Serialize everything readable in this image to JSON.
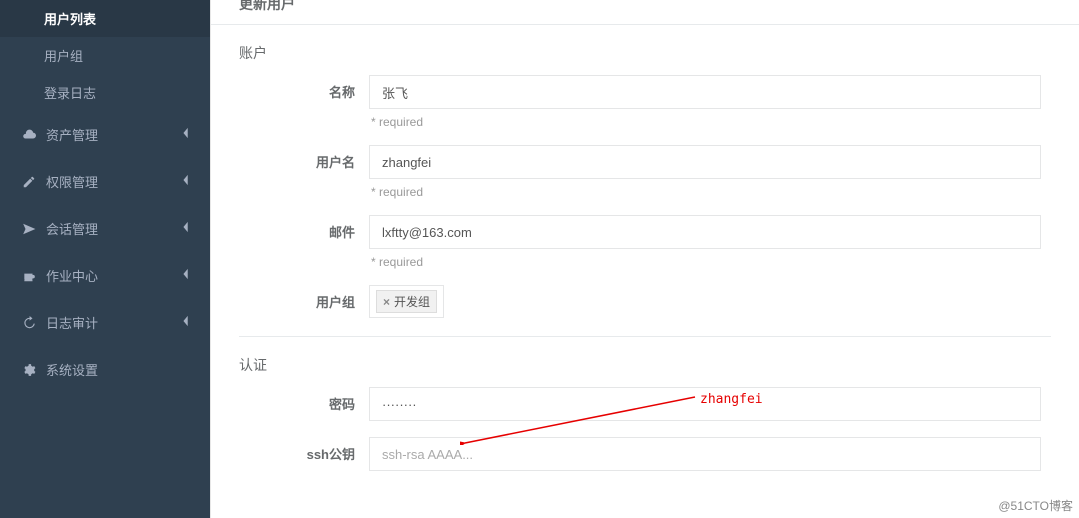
{
  "page_title": "更新用户",
  "sidebar": {
    "sub_items": [
      {
        "label": "用户列表",
        "active": true
      },
      {
        "label": "用户组",
        "active": false
      },
      {
        "label": "登录日志",
        "active": false
      }
    ],
    "nav": [
      {
        "icon": "cloud",
        "label": "资产管理"
      },
      {
        "icon": "edit",
        "label": "权限管理"
      },
      {
        "icon": "plane",
        "label": "会话管理"
      },
      {
        "icon": "coffee",
        "label": "作业中心"
      },
      {
        "icon": "history",
        "label": "日志审计"
      },
      {
        "icon": "gears",
        "label": "系统设置"
      }
    ]
  },
  "form": {
    "section_account": "账户",
    "section_auth": "认证",
    "required_text": "* required",
    "fields": {
      "name": {
        "label": "名称",
        "value": "张飞"
      },
      "username": {
        "label": "用户名",
        "value": "zhangfei"
      },
      "email": {
        "label": "邮件",
        "value": "lxftty@163.com"
      },
      "groups": {
        "label": "用户组",
        "tag": "开发组",
        "remove": "×"
      },
      "password": {
        "label": "密码",
        "value": "········"
      },
      "sshkey": {
        "label": "ssh公钥",
        "placeholder": "ssh-rsa AAAA..."
      }
    }
  },
  "annotation": {
    "text": "zhangfei"
  },
  "watermark": "@51CTO博客"
}
